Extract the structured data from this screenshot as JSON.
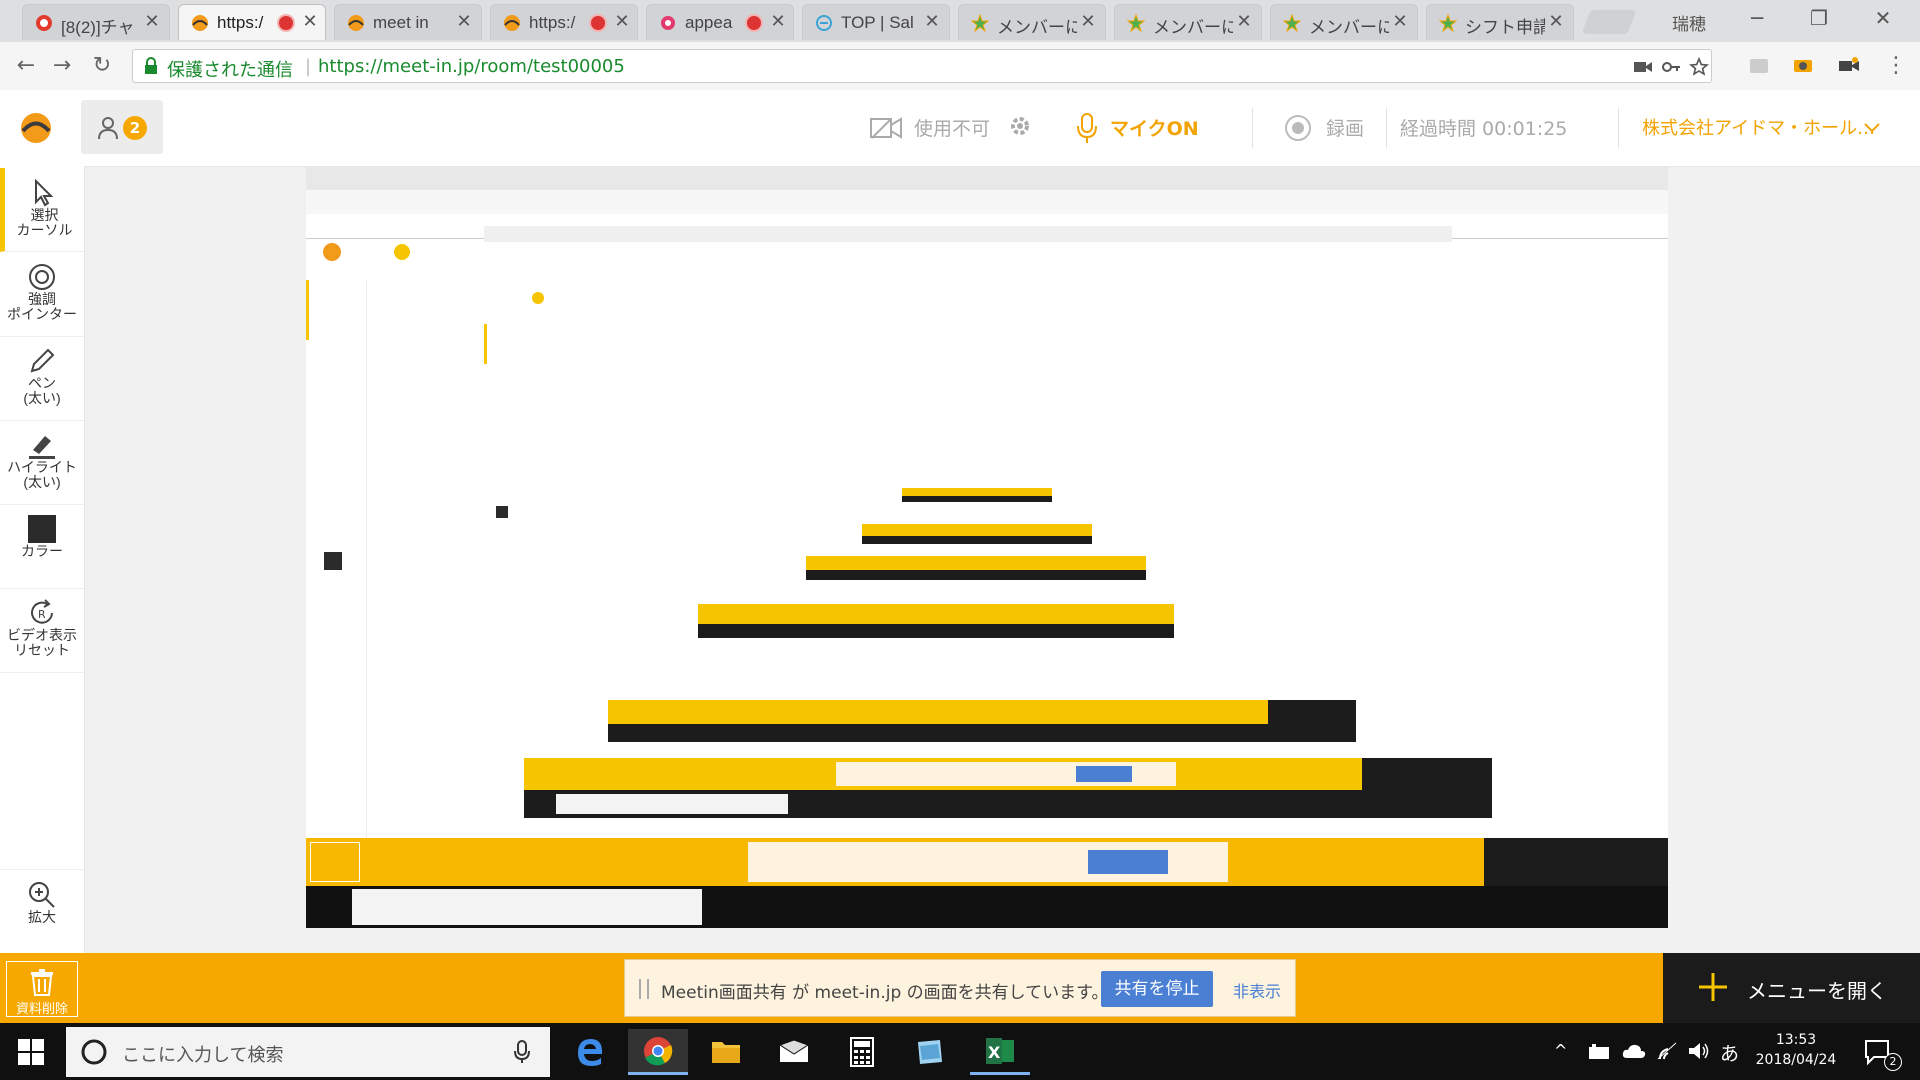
{
  "browser": {
    "tabs": [
      {
        "label": "[8(2)]チャ",
        "fav": "chat",
        "rec": false
      },
      {
        "label": "https:/",
        "fav": "meetin",
        "rec": true,
        "active": true
      },
      {
        "label": "meet in",
        "fav": "meetin",
        "rec": false
      },
      {
        "label": "https:/",
        "fav": "meetin",
        "rec": true
      },
      {
        "label": "appea",
        "fav": "appear",
        "rec": true
      },
      {
        "label": "TOP | Sal",
        "fav": "sales",
        "rec": false
      },
      {
        "label": "メンバーにフ",
        "fav": "star",
        "rec": false
      },
      {
        "label": "メンバーにフ",
        "fav": "star",
        "rec": false
      },
      {
        "label": "メンバーにフ",
        "fav": "star",
        "rec": false
      },
      {
        "label": "シフト申請",
        "fav": "star",
        "rec": false
      }
    ],
    "window_label": "瑞穂",
    "secure_label": "保護された通信",
    "url": "https://meet-in.jp/room/test00005"
  },
  "header": {
    "participant_count": "2",
    "camera_label": "使用不可",
    "mic_label": "マイクON",
    "record_label": "録画",
    "elapsed_label": "経過時間 00:01:25",
    "company": "株式会社アイドマ・ホール…"
  },
  "tools": [
    {
      "label": "選択\nカーソル",
      "icon": "cursor-icon",
      "name": "tool-select-cursor",
      "active": true
    },
    {
      "label": "強調\nポインター",
      "icon": "pointer-icon",
      "name": "tool-highlight-pointer"
    },
    {
      "label": "ペン\n(太い)",
      "icon": "pen-icon",
      "name": "tool-pen-thick"
    },
    {
      "label": "ハイライト\n(太い)",
      "icon": "highlighter-icon",
      "name": "tool-highlighter-thick"
    },
    {
      "label": "カラー",
      "icon": "color-swatch-icon",
      "name": "tool-color"
    },
    {
      "label": "ビデオ表示\nリセット",
      "icon": "video-reset-icon",
      "name": "tool-video-reset"
    }
  ],
  "zoom_label": "拡大",
  "bottom": {
    "trash_label": "資料削除",
    "share_message": "Meetin画面共有 が meet-in.jp の画面を共有しています。",
    "stop_label": "共有を停止",
    "hide_label": "非表示",
    "menu_label": "メニューを開く"
  },
  "taskbar": {
    "search_placeholder": "ここに入力して検索",
    "time": "13:53",
    "date": "2018/04/24",
    "ime": "あ",
    "notifications": "2"
  },
  "colors": {
    "accent": "#f7c400",
    "orange": "#f6a800",
    "blue": "#4a7fd4"
  }
}
